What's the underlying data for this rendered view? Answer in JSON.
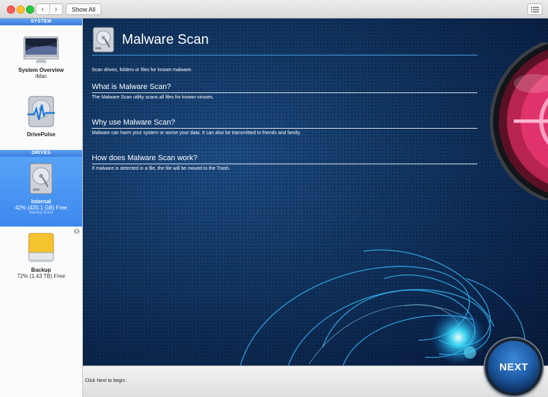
{
  "window": {
    "show_all_label": "Show All",
    "back_glyph": "‹",
    "forward_glyph": "›"
  },
  "sidebar": {
    "system_header": "SYSTEM",
    "drives_header": "DRIVES",
    "items": [
      {
        "label": "System Overview",
        "sub": "iMac",
        "icon": "imac-icon"
      },
      {
        "label": "DrivePulse",
        "icon": "drivepulse-icon"
      }
    ],
    "drives": [
      {
        "label": "Internal",
        "sub": "42% (420.1 GB) Free",
        "tiny": "Startup Drive",
        "icon": "internal-drive-icon",
        "selected": true
      },
      {
        "label": "Backup",
        "sub": "72% (1.43 TB) Free",
        "icon": "external-drive-icon"
      }
    ]
  },
  "main": {
    "title": "Malware Scan",
    "description": "Scan drives, folders or files for known malware.",
    "sections": [
      {
        "heading": "What is Malware Scan?",
        "text": "The Malware Scan utility scans all files for known viruses."
      },
      {
        "heading": "Why use Malware Scan?",
        "text": "Malware can harm your system or worse your data. It can also be transmitted to friends and family."
      },
      {
        "heading": "How does Malware Scan work?",
        "text": "If malware is detected in a file, the file will be moved to the Trash."
      }
    ]
  },
  "footer": {
    "hint": "Click Next to begin.",
    "next_label": "NEXT"
  },
  "colors": {
    "accent": "#3e88ee",
    "background": "#0f2f5c",
    "lens": "#e0336b"
  }
}
